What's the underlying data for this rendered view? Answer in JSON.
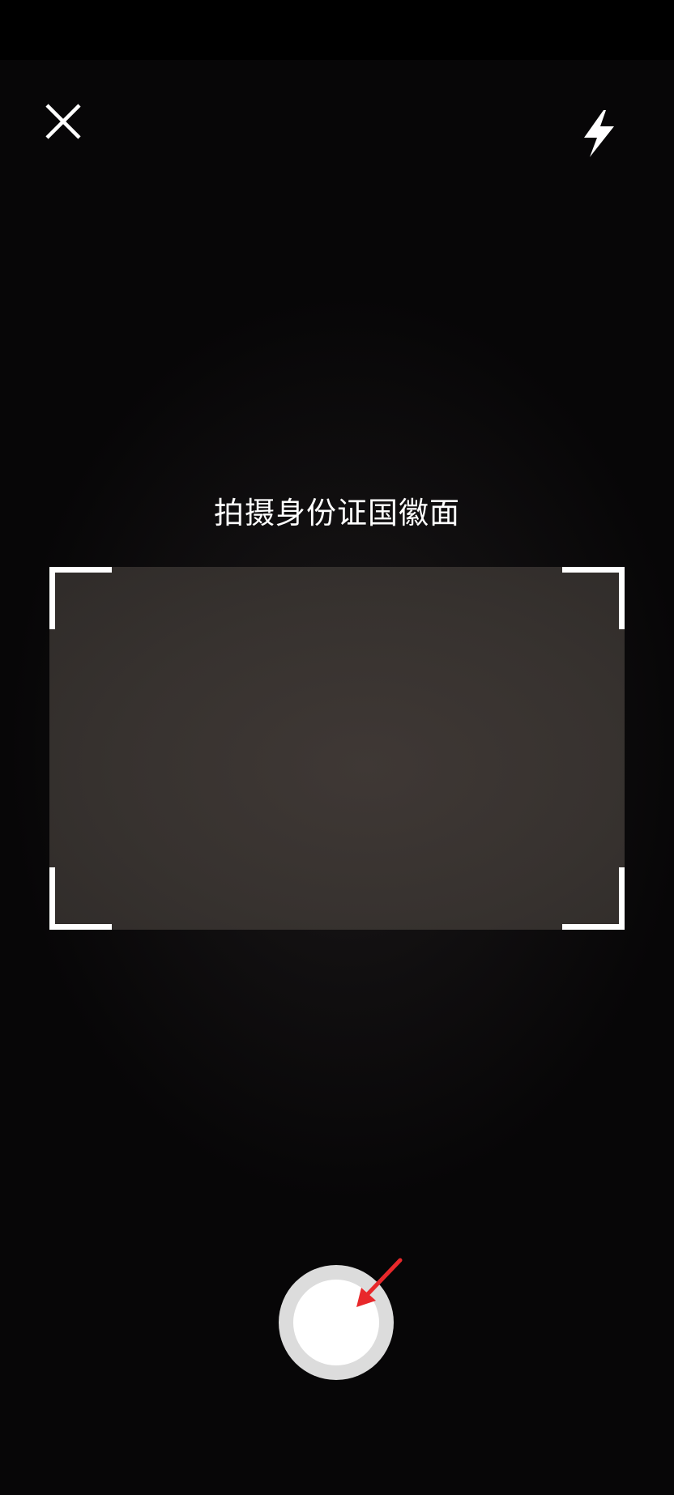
{
  "camera": {
    "instruction_text": "拍摄身份证国徽面",
    "close_icon": "close-icon",
    "flash_icon": "flash-icon",
    "shutter_icon": "shutter-button",
    "annotation_arrow_color": "#e8282b"
  }
}
